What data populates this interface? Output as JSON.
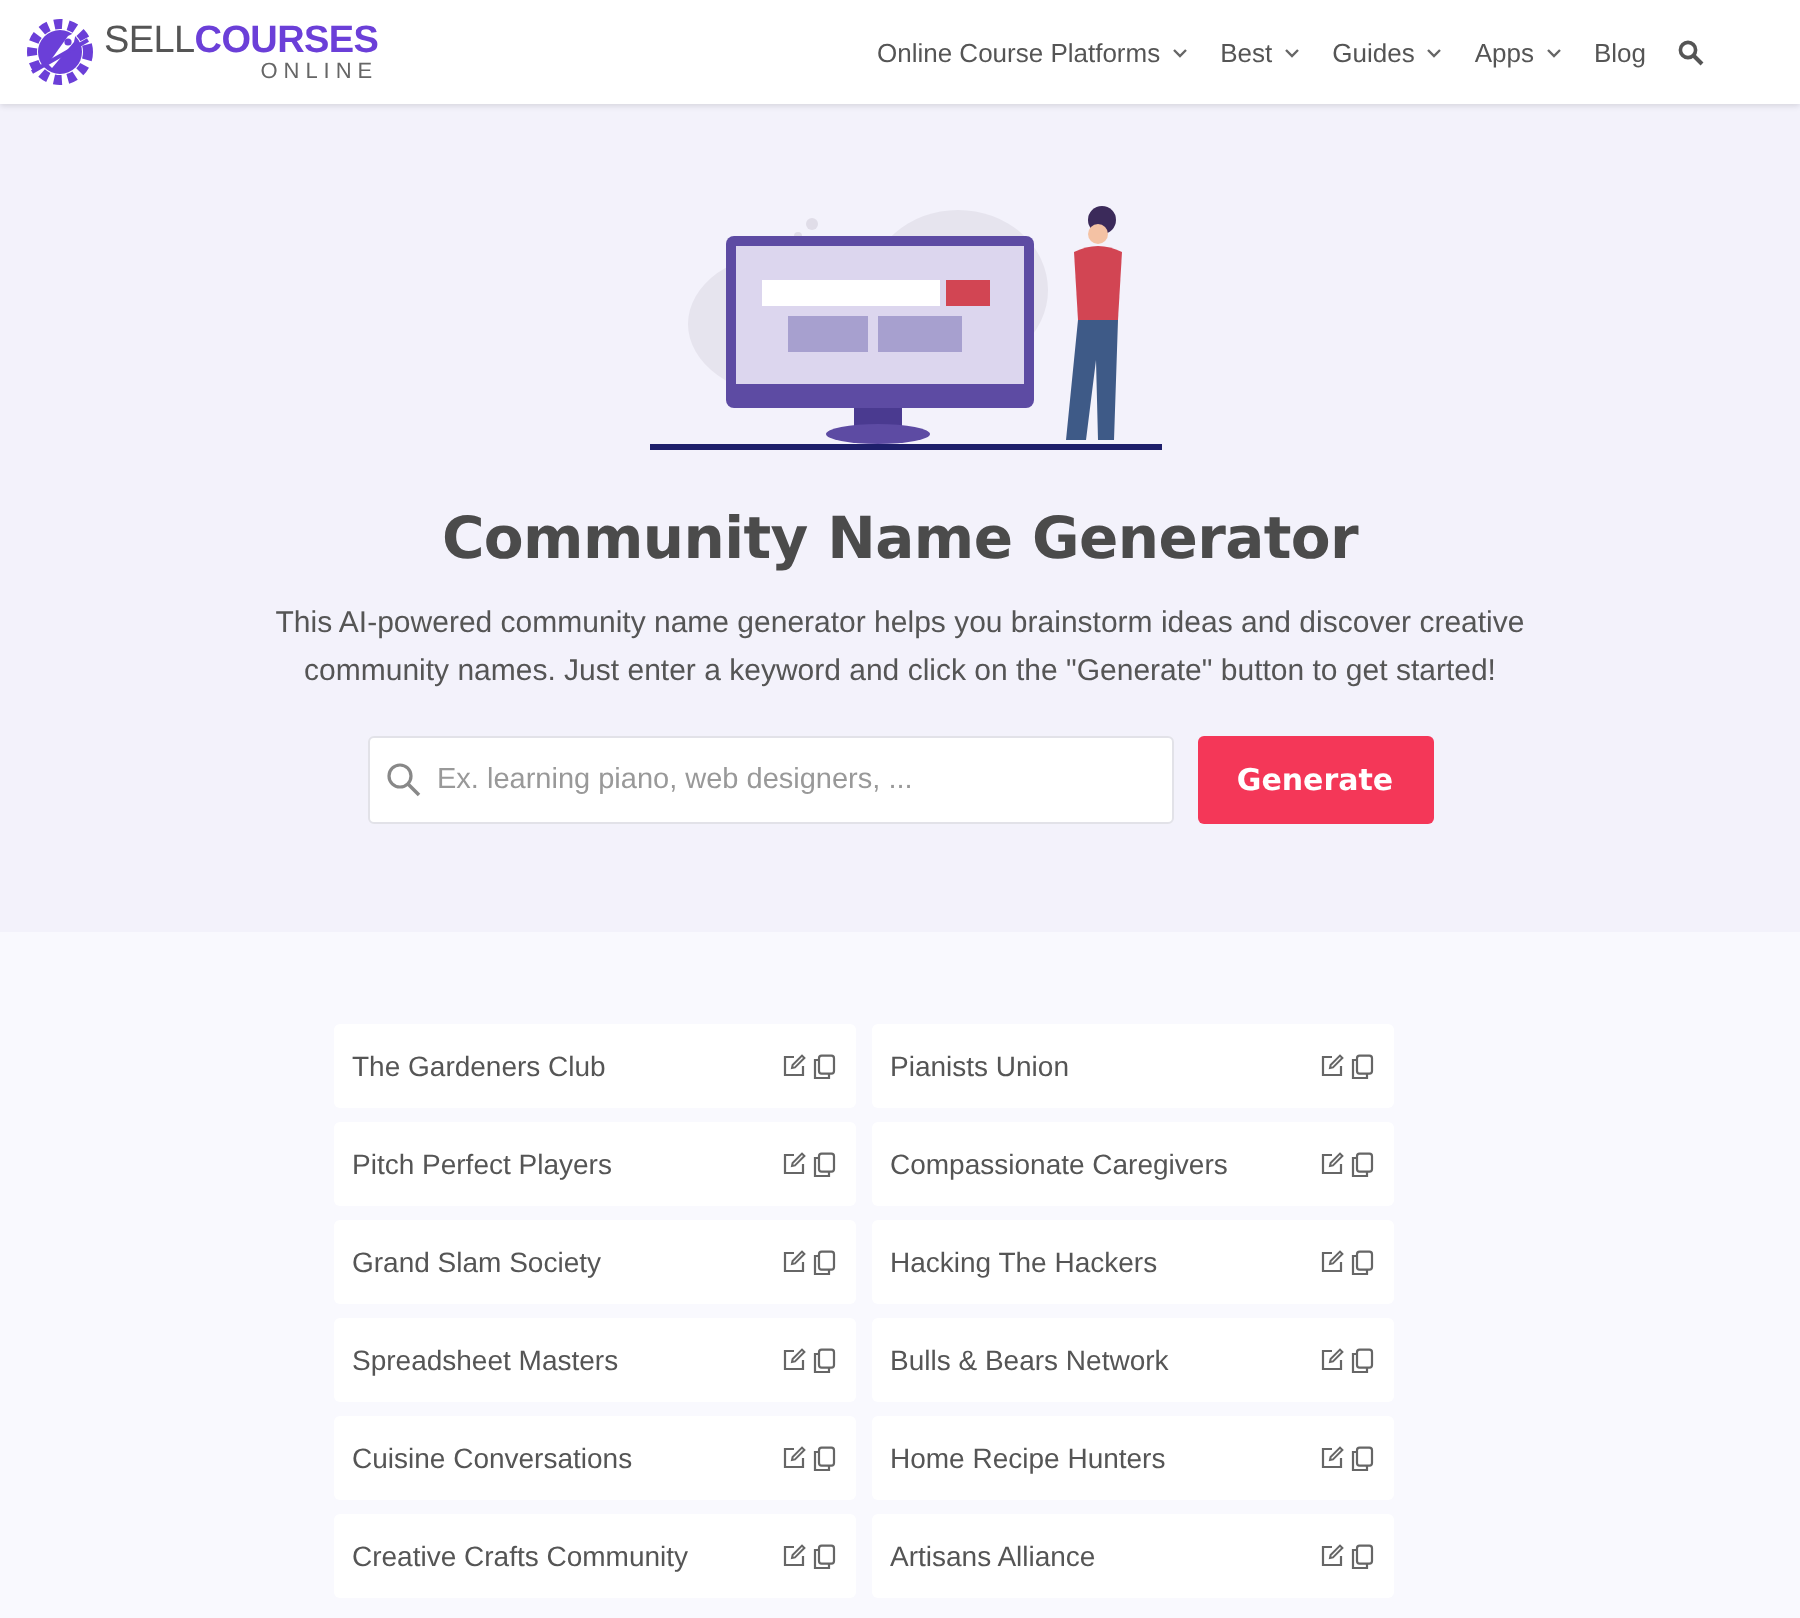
{
  "header": {
    "logo": {
      "light": "SELL",
      "bold": "COURSES",
      "sub": "ONLINE"
    },
    "nav": [
      {
        "label": "Online Course Platforms",
        "has_dropdown": true
      },
      {
        "label": "Best",
        "has_dropdown": true
      },
      {
        "label": "Guides",
        "has_dropdown": true
      },
      {
        "label": "Apps",
        "has_dropdown": true
      },
      {
        "label": "Blog",
        "has_dropdown": false
      }
    ]
  },
  "hero": {
    "title": "Community Name Generator",
    "description": "This AI-powered community name generator helps you brainstorm ideas and discover creative community names. Just enter a keyword and click on the \"Generate\" button to get started!",
    "search": {
      "placeholder": "Ex. learning piano, web designers, ..."
    },
    "button": "Generate"
  },
  "results": [
    {
      "name": "The Gardeners Club"
    },
    {
      "name": "Pianists Union"
    },
    {
      "name": "Pitch Perfect Players"
    },
    {
      "name": "Compassionate Caregivers"
    },
    {
      "name": "Grand Slam Society"
    },
    {
      "name": "Hacking The Hackers"
    },
    {
      "name": "Spreadsheet Masters"
    },
    {
      "name": "Bulls & Bears Network"
    },
    {
      "name": "Cuisine Conversations"
    },
    {
      "name": "Home Recipe Hunters"
    },
    {
      "name": "Creative Crafts Community"
    },
    {
      "name": "Artisans Alliance"
    }
  ]
}
